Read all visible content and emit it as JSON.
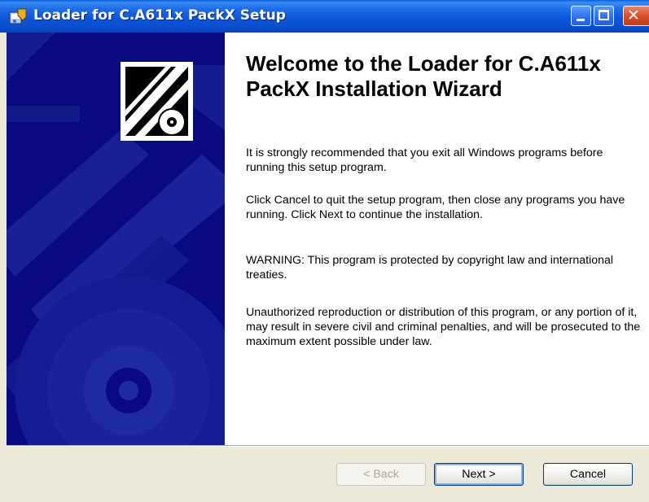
{
  "window": {
    "title": "Loader for C.A611x PackX Setup",
    "icon": "setup-icon",
    "controls": {
      "minimize": "minimize-icon",
      "maximize": "maximize-icon",
      "close": "✕"
    }
  },
  "content": {
    "title": "Welcome to the Loader for C.A611x PackX Installation Wizard",
    "paragraphs": [
      "It is strongly recommended that you exit all Windows programs before running this setup program.",
      "Click Cancel to quit the setup program, then close any programs you have running.  Click Next to continue the installation.",
      "WARNING: This program is protected by copyright law and international treaties.",
      "Unauthorized reproduction or distribution of this program, or any portion of it, may result in severe civil and criminal penalties, and will be prosecuted to the maximum extent possible under law."
    ]
  },
  "buttons": {
    "back": "< Back",
    "next": "Next >",
    "cancel": "Cancel"
  },
  "colors": {
    "titlebar": "#0c56d9",
    "banner": "#0a0a80",
    "panel": "#ffffff",
    "dialog": "#ece9d8"
  }
}
